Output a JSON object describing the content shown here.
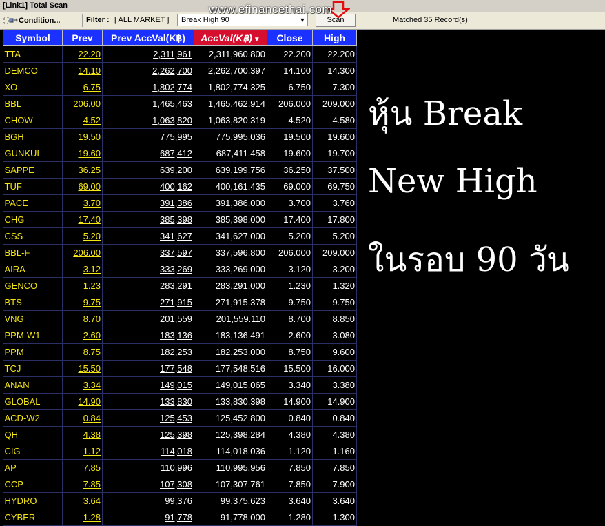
{
  "window_title": "[Link1] Total Scan",
  "watermark": "www.efinancethai.com",
  "toolbar": {
    "condition_label": "Condition...",
    "filter_label": "Filter :",
    "market": "[ ALL MARKET ]",
    "scan_type": "Break High 90",
    "scan_label": "Scan",
    "matched": "Matched 35 Record(s)"
  },
  "columns": [
    "Symbol",
    "Prev",
    "Prev AccVal(K฿)",
    "AccVal(K฿)",
    "Close",
    "High"
  ],
  "rows": [
    [
      "TTA",
      "22.20",
      "2,311,961",
      "2,311,960.800",
      "22.200",
      "22.200"
    ],
    [
      "DEMCO",
      "14.10",
      "2,262,700",
      "2,262,700.397",
      "14.100",
      "14.300"
    ],
    [
      "XO",
      "6.75",
      "1,802,774",
      "1,802,774.325",
      "6.750",
      "7.300"
    ],
    [
      "BBL",
      "206.00",
      "1,465,463",
      "1,465,462.914",
      "206.000",
      "209.000"
    ],
    [
      "CHOW",
      "4.52",
      "1,063,820",
      "1,063,820.319",
      "4.520",
      "4.580"
    ],
    [
      "BGH",
      "19.50",
      "775,995",
      "775,995.036",
      "19.500",
      "19.600"
    ],
    [
      "GUNKUL",
      "19.60",
      "687,412",
      "687,411.458",
      "19.600",
      "19.700"
    ],
    [
      "SAPPE",
      "36.25",
      "639,200",
      "639,199.756",
      "36.250",
      "37.500"
    ],
    [
      "TUF",
      "69.00",
      "400,162",
      "400,161.435",
      "69.000",
      "69.750"
    ],
    [
      "PACE",
      "3.70",
      "391,386",
      "391,386.000",
      "3.700",
      "3.760"
    ],
    [
      "CHG",
      "17.40",
      "385,398",
      "385,398.000",
      "17.400",
      "17.800"
    ],
    [
      "CSS",
      "5.20",
      "341,627",
      "341,627.000",
      "5.200",
      "5.200"
    ],
    [
      "BBL-F",
      "206.00",
      "337,597",
      "337,596.800",
      "206.000",
      "209.000"
    ],
    [
      "AIRA",
      "3.12",
      "333,269",
      "333,269.000",
      "3.120",
      "3.200"
    ],
    [
      "GENCO",
      "1.23",
      "283,291",
      "283,291.000",
      "1.230",
      "1.320"
    ],
    [
      "BTS",
      "9.75",
      "271,915",
      "271,915.378",
      "9.750",
      "9.750"
    ],
    [
      "VNG",
      "8.70",
      "201,559",
      "201,559.110",
      "8.700",
      "8.850"
    ],
    [
      "PPM-W1",
      "2.60",
      "183,136",
      "183,136.491",
      "2.600",
      "3.080"
    ],
    [
      "PPM",
      "8.75",
      "182,253",
      "182,253.000",
      "8.750",
      "9.600"
    ],
    [
      "TCJ",
      "15.50",
      "177,548",
      "177,548.516",
      "15.500",
      "16.000"
    ],
    [
      "ANAN",
      "3.34",
      "149,015",
      "149,015.065",
      "3.340",
      "3.380"
    ],
    [
      "GLOBAL",
      "14.90",
      "133,830",
      "133,830.398",
      "14.900",
      "14.900"
    ],
    [
      "ACD-W2",
      "0.84",
      "125,453",
      "125,452.800",
      "0.840",
      "0.840"
    ],
    [
      "QH",
      "4.38",
      "125,398",
      "125,398.284",
      "4.380",
      "4.380"
    ],
    [
      "CIG",
      "1.12",
      "114,018",
      "114,018.036",
      "1.120",
      "1.160"
    ],
    [
      "AP",
      "7.85",
      "110,996",
      "110,995.956",
      "7.850",
      "7.850"
    ],
    [
      "CCP",
      "7.85",
      "107,308",
      "107,307.761",
      "7.850",
      "7.900"
    ],
    [
      "HYDRO",
      "3.64",
      "99,376",
      "99,375.623",
      "3.640",
      "3.640"
    ],
    [
      "CYBER",
      "1.28",
      "91,778",
      "91,778.000",
      "1.280",
      "1.300"
    ]
  ],
  "overlay_text": {
    "line1": "หุ้น Break",
    "line2": "New High",
    "line3": "ในรอบ 90 วัน"
  },
  "colors": {
    "header_blue": "#1b31ff",
    "header_active_red": "#d70f2f",
    "symbol_yellow": "#f4e514",
    "background": "#000000"
  }
}
